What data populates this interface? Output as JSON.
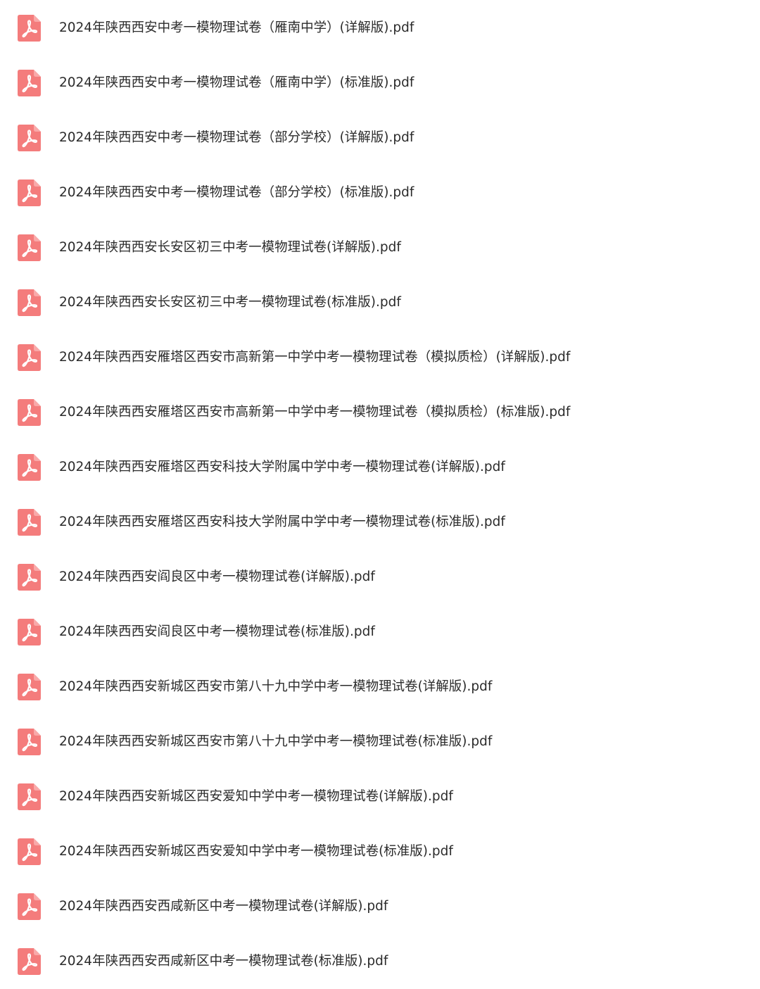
{
  "icon": {
    "name": "pdf-file-icon",
    "color": "#f47c7c",
    "symbol_color": "#ffffff"
  },
  "files": [
    {
      "name": "2024年陕西西安中考一模物理试卷（雁南中学）(详解版).pdf"
    },
    {
      "name": "2024年陕西西安中考一模物理试卷（雁南中学）(标准版).pdf"
    },
    {
      "name": "2024年陕西西安中考一模物理试卷（部分学校）(详解版).pdf"
    },
    {
      "name": "2024年陕西西安中考一模物理试卷（部分学校）(标准版).pdf"
    },
    {
      "name": "2024年陕西西安长安区初三中考一模物理试卷(详解版).pdf"
    },
    {
      "name": "2024年陕西西安长安区初三中考一模物理试卷(标准版).pdf"
    },
    {
      "name": "2024年陕西西安雁塔区西安市高新第一中学中考一模物理试卷（模拟质检）(详解版).pdf"
    },
    {
      "name": "2024年陕西西安雁塔区西安市高新第一中学中考一模物理试卷（模拟质检）(标准版).pdf"
    },
    {
      "name": "2024年陕西西安雁塔区西安科技大学附属中学中考一模物理试卷(详解版).pdf"
    },
    {
      "name": "2024年陕西西安雁塔区西安科技大学附属中学中考一模物理试卷(标准版).pdf"
    },
    {
      "name": "2024年陕西西安阎良区中考一模物理试卷(详解版).pdf"
    },
    {
      "name": "2024年陕西西安阎良区中考一模物理试卷(标准版).pdf"
    },
    {
      "name": "2024年陕西西安新城区西安市第八十九中学中考一模物理试卷(详解版).pdf"
    },
    {
      "name": "2024年陕西西安新城区西安市第八十九中学中考一模物理试卷(标准版).pdf"
    },
    {
      "name": "2024年陕西西安新城区西安爱知中学中考一模物理试卷(详解版).pdf"
    },
    {
      "name": "2024年陕西西安新城区西安爱知中学中考一模物理试卷(标准版).pdf"
    },
    {
      "name": "2024年陕西西安西咸新区中考一模物理试卷(详解版).pdf"
    },
    {
      "name": "2024年陕西西安西咸新区中考一模物理试卷(标准版).pdf"
    }
  ]
}
